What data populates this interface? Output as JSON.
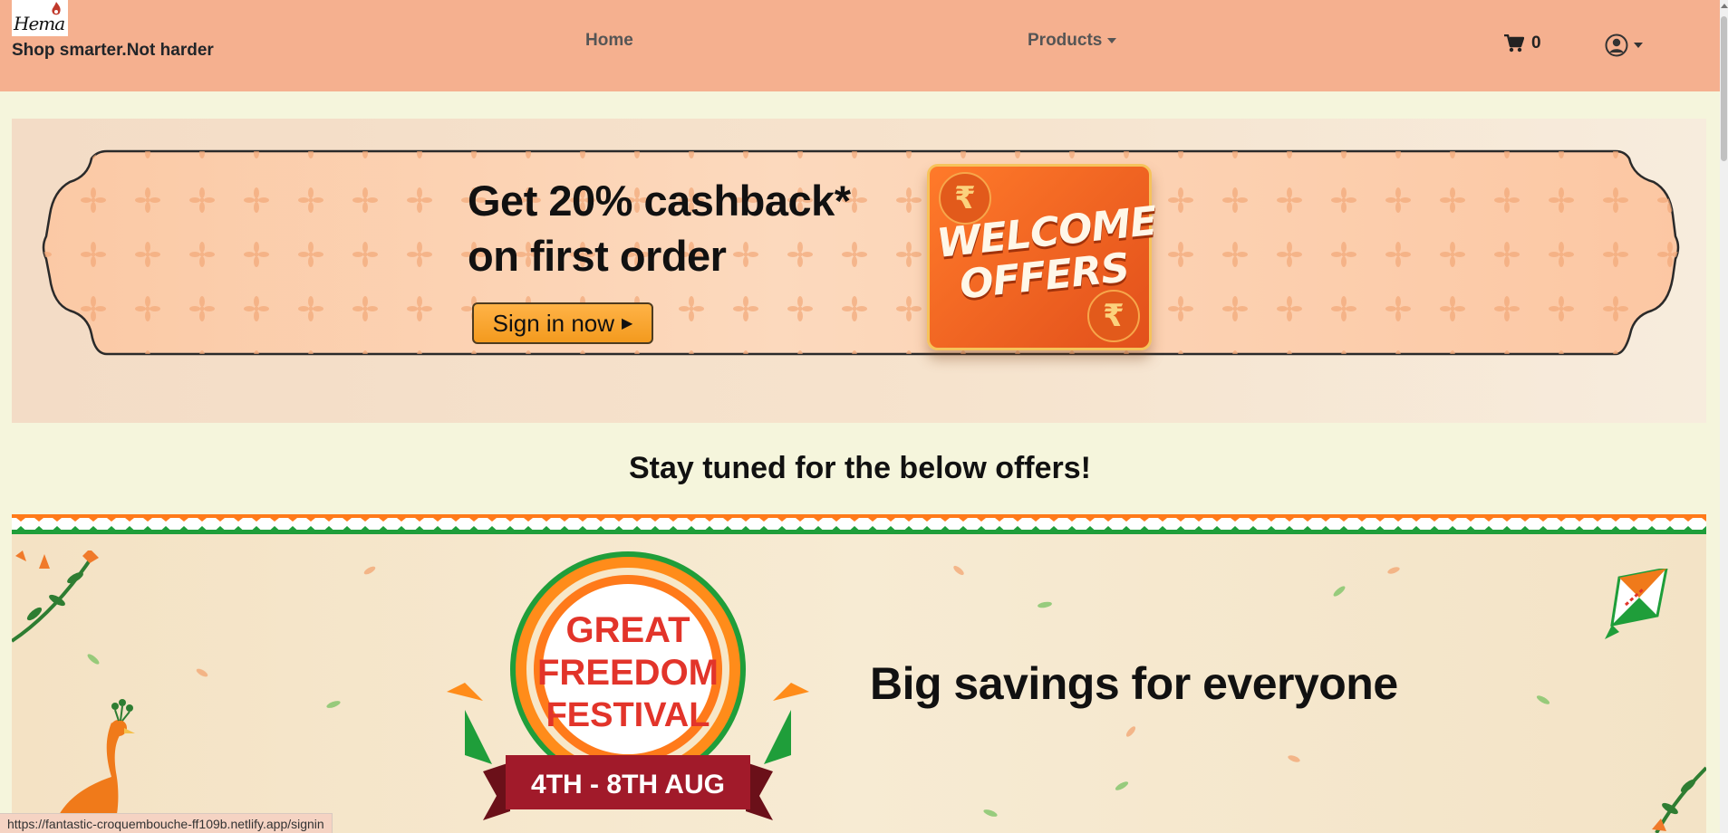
{
  "navbar": {
    "logo_text": "Hema",
    "tagline": "Shop smarter.Not harder",
    "home_label": "Home",
    "products_label": "Products",
    "cart_count": "0",
    "background": "#f5b08f"
  },
  "banner_welcome": {
    "line1": "Get 20% cashback*",
    "line2": "on first order",
    "signin_label": "Sign in now",
    "card_text_1": "WELCOME",
    "card_text_2": "OFFERS",
    "rupee_symbol": "₹"
  },
  "section_heading": "Stay tuned for the below offers!",
  "banner_festival": {
    "badge_line1": "GREAT",
    "badge_line2": "FREEDOM",
    "badge_line3": "FESTIVAL",
    "badge_dates": "4TH - 8TH AUG",
    "headline": "Big savings for everyone"
  },
  "status_bar_url": "https://fantastic-croquembouche-ff109b.netlify.app/signin",
  "colors": {
    "page_background": "#f5f5dc",
    "saffron": "#ff8c1a",
    "green": "#1f9e3a",
    "festival_red": "#e2342a"
  }
}
